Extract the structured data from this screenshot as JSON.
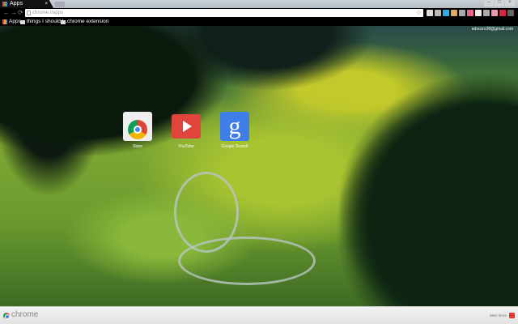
{
  "tab": {
    "title": "Apps",
    "close": "×"
  },
  "window": {
    "minimize": "–",
    "maximize": "□",
    "close": "×"
  },
  "toolbar": {
    "back": "←",
    "forward": "→",
    "reload": "⟳",
    "url": "chrome://apps",
    "star": "☆"
  },
  "bookmarks": [
    {
      "label": "Apps",
      "icon": "apps-grid-icon"
    },
    {
      "label": "things I should l...",
      "icon": "folder-icon"
    },
    {
      "label": "chrome extension",
      "icon": "folder-icon"
    }
  ],
  "account": {
    "email": "edscoro38@gmail.com"
  },
  "apps": [
    {
      "label": "Store"
    },
    {
      "label": "YouTube"
    },
    {
      "label": "Google Search"
    }
  ],
  "bottom": {
    "brand": "chrome",
    "webstore": "Web Store"
  },
  "extensions": [
    "#ddd",
    "#bbb",
    "#3ad",
    "#da6",
    "#aaa",
    "#e68",
    "#eee",
    "#aaa",
    "#e9a",
    "#d24",
    "#666"
  ]
}
